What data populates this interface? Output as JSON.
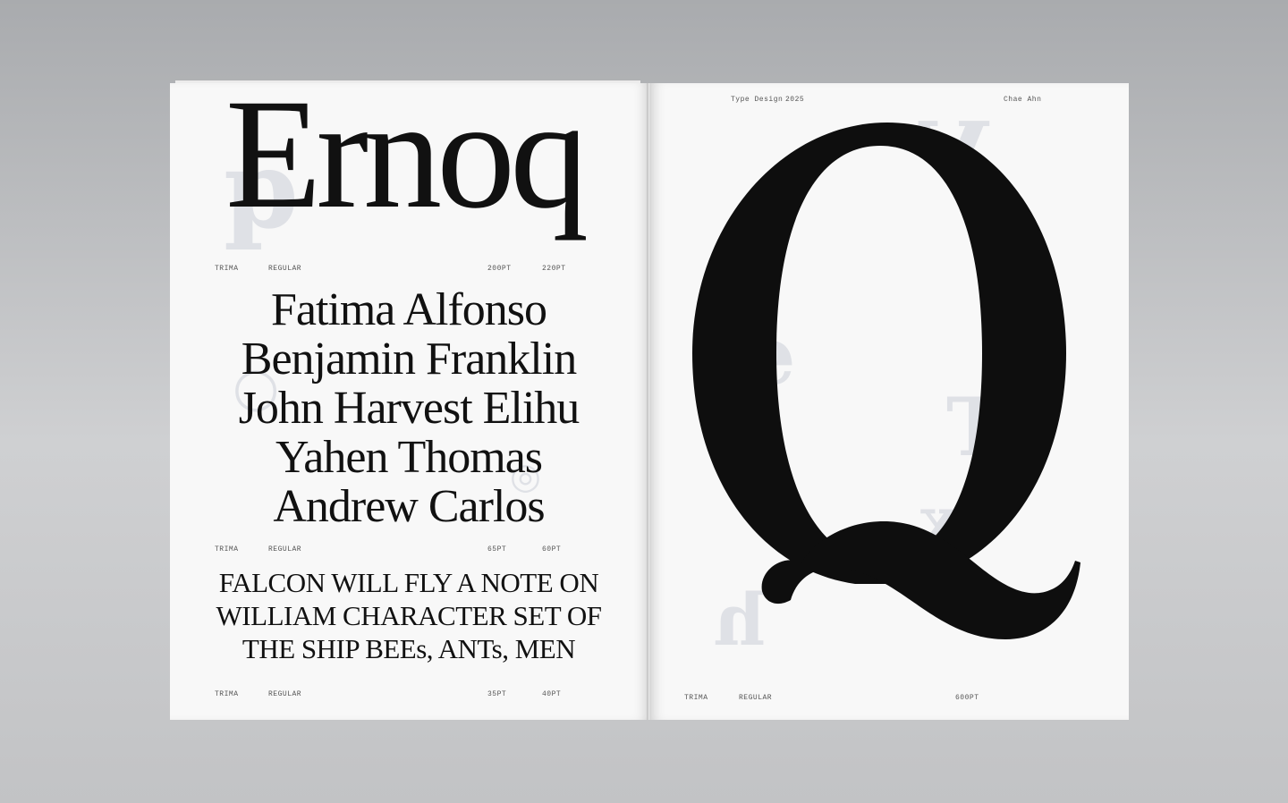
{
  "left_page": {
    "headline": "Ernoq",
    "spec_1": {
      "family": "TRIMA",
      "style": "REGULAR",
      "size_a": "200PT",
      "size_b": "220PT"
    },
    "names": [
      "Fatima Alfonso",
      "Benjamin Franklin",
      "John Harvest Elihu",
      "Yahen Thomas",
      "Andrew Carlos"
    ],
    "spec_2": {
      "family": "TRIMA",
      "style": "REGULAR",
      "size_a": "65PT",
      "size_b": "60PT"
    },
    "caps_lines": [
      "FALCON WILL FLY A NOTE ON",
      "WILLIAM CHARACTER SET OF",
      "THE SHIP BEEs, ANTs, MEN"
    ],
    "spec_3": {
      "family": "TRIMA",
      "style": "REGULAR",
      "size_a": "35PT",
      "size_b": "40PT"
    }
  },
  "right_page": {
    "header": {
      "section": "Type Design",
      "year": "2025",
      "author": "Chae Ahn"
    },
    "glyph": "Q",
    "spec": {
      "family": "TRIMA",
      "style": "REGULAR",
      "size": "600PT"
    }
  },
  "colors": {
    "background": "#b9babd",
    "paper": "#f8f8f8",
    "ink": "#111111",
    "ghost_ink": "#dfe1e6"
  }
}
